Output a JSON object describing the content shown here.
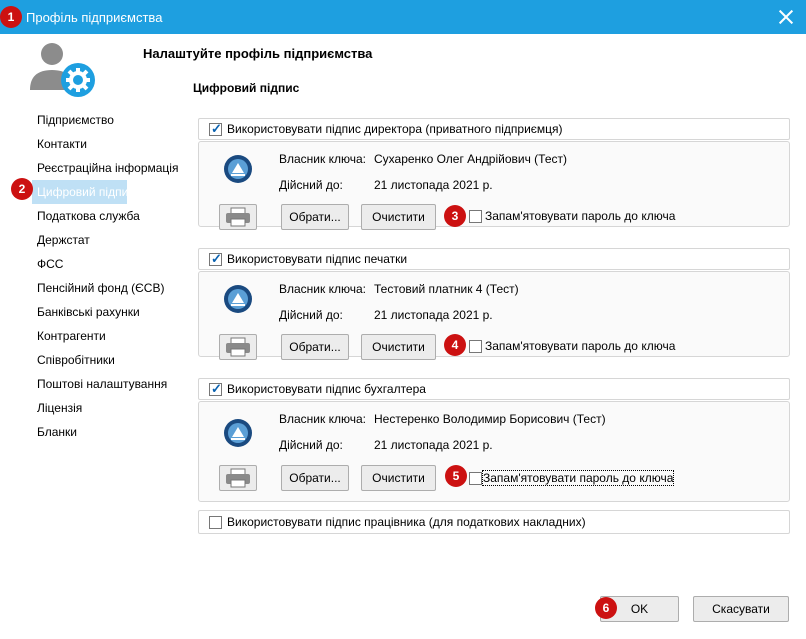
{
  "window": {
    "title": "Профіль підприємства",
    "accent": "#1e9fe0"
  },
  "heading": "Налаштуйте профіль підприємства",
  "section_title": "Цифровий підпис",
  "sidebar": {
    "items": [
      {
        "label": "Підприємство"
      },
      {
        "label": "Контакти"
      },
      {
        "label": "Реєстраційна інформація"
      },
      {
        "label": "Цифровий підпис"
      },
      {
        "label": "Податкова служба"
      },
      {
        "label": "Держстат"
      },
      {
        "label": "ФСС"
      },
      {
        "label": "Пенсійний фонд (ЄСВ)"
      },
      {
        "label": "Банківські рахунки"
      },
      {
        "label": "Контрагенти"
      },
      {
        "label": "Співробітники"
      },
      {
        "label": "Поштові налаштування"
      },
      {
        "label": "Ліцензія"
      },
      {
        "label": "Бланки"
      }
    ],
    "active_index": 3
  },
  "key_owner_label": "Власник ключа:",
  "valid_until_label": "Дійсний до:",
  "choose_label": "Обрати...",
  "clear_label": "Очистити",
  "remember_label": "Запам'ятовувати пароль до ключа",
  "groups": [
    {
      "checkbox_label": "Використовувати підпис директора (приватного підприємця)",
      "checked": true,
      "owner": "Сухаренко Олег Андрійович (Тест)",
      "valid": "21 листопада 2021 р.",
      "remember": false
    },
    {
      "checkbox_label": "Використовувати підпис печатки",
      "checked": true,
      "owner": "Тестовий платник 4 (Тест)",
      "valid": "21 листопада 2021 р.",
      "remember": false
    },
    {
      "checkbox_label": "Використовувати підпис бухгалтера",
      "checked": true,
      "owner": "Нестеренко Володимир Борисович (Тест)",
      "valid": "21 листопада 2021 р.",
      "remember": false
    }
  ],
  "employee_checkbox": {
    "label": "Використовувати підпис працівника (для податкових накладних)",
    "checked": false
  },
  "footer": {
    "ok_label": "OK",
    "cancel_label": "Скасувати"
  },
  "badges": [
    "1",
    "2",
    "3",
    "4",
    "5",
    "6"
  ]
}
